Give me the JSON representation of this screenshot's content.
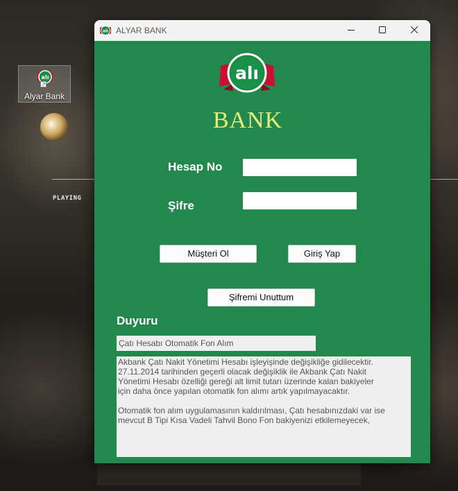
{
  "desktop": {
    "shortcut_label": "Alyar Bank",
    "bg_text": "PLAYING"
  },
  "window": {
    "title": "ALYAR BANK",
    "controls": [
      "minimize",
      "maximize",
      "close"
    ]
  },
  "brand": {
    "logo_text": "alı",
    "bank_text": "BANK",
    "colors": {
      "green": "#22884e",
      "accent_yellow": "#e2f07a",
      "logo_red": "#c8102e"
    }
  },
  "login": {
    "hesap_label": "Hesap No",
    "hesap_value": "",
    "sifre_label": "Şifre",
    "sifre_value": ""
  },
  "buttons": {
    "musteri": "Müşteri Ol",
    "giris": "Giriş Yap",
    "sifremi": "Şifremi Unuttum"
  },
  "announcement": {
    "heading": "Duyuru",
    "title": "Çatı Hesabı Otomatik Fon Alım",
    "body": "Akbank Çatı Nakit Yönetimi Hesabı işleyişinde değişikliğe gidilecektir.\n27.11.2014 tarihinden geçerli olacak değişiklik ile Akbank Çatı Nakit\nYönetimi Hesabı özelliği gereği alt limit tutarı üzerinde kalan bakiyeler\niçin daha önce yapılan otomatik fon alımı artık yapılmayacaktır.\n\nOtomatik fon alım uygulamasının kaldırılması, Çatı hesabınızdaki var ise\nmevcut B Tipi Kısa Vadeli Tahvil Bono Fon bakiyenizi etkilemeyecek,"
  }
}
